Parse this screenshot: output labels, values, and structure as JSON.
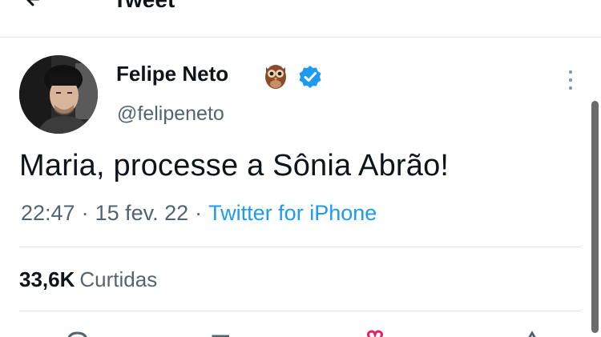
{
  "header": {
    "title": "Tweet"
  },
  "author": {
    "display_name": "Felipe Neto",
    "handle": "@felipeneto",
    "verified": true
  },
  "tweet": {
    "text": "Maria, processe a Sônia Abrão!",
    "time": "22:47",
    "date": "15 fev. 22",
    "separator": "·",
    "source": "Twitter for iPhone"
  },
  "stats": {
    "likes_count": "33,6K",
    "likes_label": "Curtidas"
  },
  "colors": {
    "link": "#1d9bf0",
    "secondary_text": "#536471",
    "verified": "#1d9bf0",
    "primary_text": "#0f1419"
  },
  "icons": {
    "back": "arrow-left-icon",
    "emoji": "owl-emoji-icon",
    "verified": "verified-badge-icon",
    "more": "more-vertical-icon",
    "reply": "reply-icon",
    "retweet": "retweet-icon",
    "like": "heart-icon",
    "share": "share-icon"
  }
}
